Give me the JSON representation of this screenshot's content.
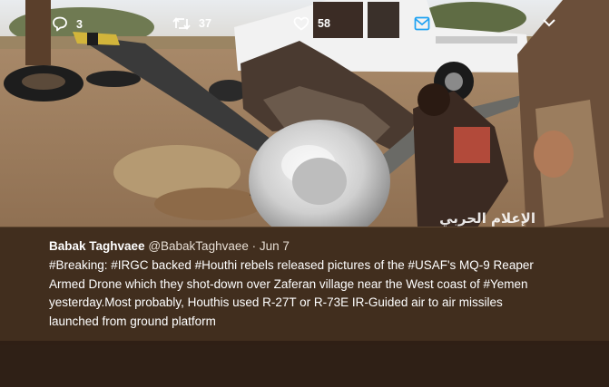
{
  "photo": {
    "description_icon": "photo-image",
    "watermark_text": "الإعلام الحربي"
  },
  "tweet": {
    "author_name": "Babak Taghvaee",
    "author_handle": "@BabakTaghvaee",
    "separator": "·",
    "date": "Jun 7",
    "text": "#Breaking: #IRGC backed #Houthi rebels released pictures of the #USAF's MQ-9 Reaper\nArmed Drone which they shot-down over Zaferan village near the West coast of #Yemen\nyesterday.Most probably, Houthis used R-27T or R-73E IR-Guided air to air missiles\nlaunched from ground platform"
  },
  "actions": {
    "reply_icon": "reply-icon",
    "reply_count": "3",
    "retweet_icon": "retweet-icon",
    "retweet_count": "37",
    "like_icon": "heart-icon",
    "like_count": "58",
    "message_icon": "envelope-icon",
    "more_icon": "chevron-down-icon"
  },
  "colors": {
    "overlay": "#3a281a",
    "text": "#ffffff",
    "message_icon": "#1da1f2"
  }
}
